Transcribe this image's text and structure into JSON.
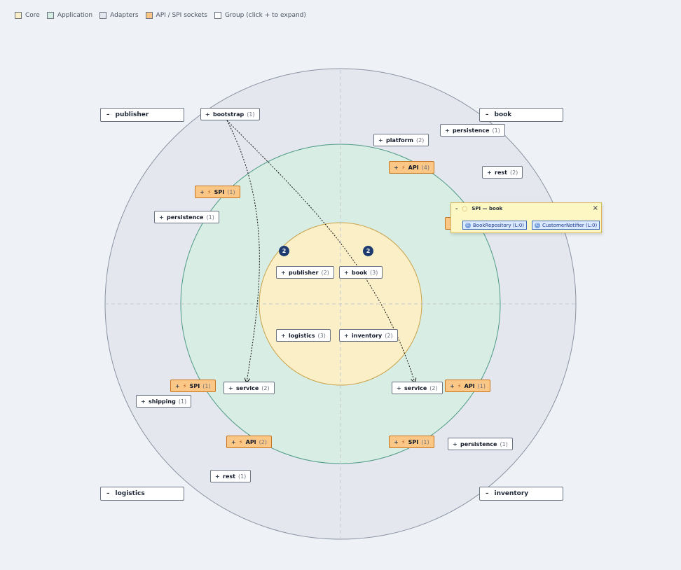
{
  "legend": [
    {
      "label": "Core",
      "color": "#fbefc7"
    },
    {
      "label": "Application",
      "color": "#d7ede3"
    },
    {
      "label": "Adapters",
      "color": "#e4e7ee"
    },
    {
      "label": "API / SPI sockets",
      "color": "#fbc787"
    },
    {
      "label": "Group (click + to expand)",
      "color": "#ffffff"
    }
  ],
  "colors": {
    "core_fill": "#fbefc7",
    "core_stroke": "#c9a24a",
    "app_fill": "#d8ede3",
    "app_stroke": "#4e9a86",
    "adapter_fill": "#e4e7ee",
    "adapter_stroke": "#8a93a3",
    "socket": "#fbc787",
    "badge": "#1e3a6e"
  },
  "groups": {
    "publisher": {
      "toggle": "–",
      "label": "publisher"
    },
    "book": {
      "toggle": "–",
      "label": "book"
    },
    "logistics": {
      "toggle": "–",
      "label": "logistics"
    },
    "inventory": {
      "toggle": "–",
      "label": "inventory"
    }
  },
  "core": {
    "publisher": {
      "toggle": "+",
      "name": "publisher",
      "count": "(2)"
    },
    "book": {
      "toggle": "+",
      "name": "book",
      "count": "(3)"
    },
    "logistics": {
      "toggle": "+",
      "name": "logistics",
      "count": "(3)"
    },
    "inventory": {
      "toggle": "+",
      "name": "inventory",
      "count": "(2)"
    },
    "badge_left": "2",
    "badge_right": "2"
  },
  "app": {
    "platform": {
      "toggle": "+",
      "name": "platform",
      "count": "(2)"
    },
    "service_left": {
      "toggle": "+",
      "name": "service",
      "count": "(2)"
    },
    "service_right": {
      "toggle": "+",
      "name": "service",
      "count": "(2)"
    }
  },
  "sockets": {
    "api_top": {
      "toggle": "+",
      "name": "API",
      "count": "(4)",
      "icon": "plug-icon"
    },
    "spi_topleft": {
      "toggle": "+",
      "name": "SPI",
      "count": "(1)",
      "icon": "plug-icon"
    },
    "spi_left": {
      "toggle": "+",
      "name": "SPI",
      "count": "(1)",
      "icon": "plug-icon"
    },
    "api_right": {
      "toggle": "+",
      "name": "API",
      "count": "(1)",
      "icon": "plug-icon"
    },
    "api_bottomleft": {
      "toggle": "+",
      "name": "API",
      "count": "(2)",
      "icon": "plug-icon"
    },
    "spi_bottomright": {
      "toggle": "+",
      "name": "SPI",
      "count": "(1)",
      "icon": "plug-icon"
    }
  },
  "adapters": {
    "bootstrap": {
      "toggle": "+",
      "name": "bootstrap",
      "count": "(1)"
    },
    "persistence_pub": {
      "toggle": "+",
      "name": "persistence",
      "count": "(1)"
    },
    "persistence_book": {
      "toggle": "+",
      "name": "persistence",
      "count": "(1)"
    },
    "rest_book": {
      "toggle": "+",
      "name": "rest",
      "count": "(2)"
    },
    "shipping": {
      "toggle": "+",
      "name": "shipping",
      "count": "(1)"
    },
    "rest_log": {
      "toggle": "+",
      "name": "rest",
      "count": "(1)"
    },
    "persistence_inv": {
      "toggle": "+",
      "name": "persistence",
      "count": "(1)"
    }
  },
  "popup": {
    "toggle": "–",
    "title": "SPI — book",
    "close": "×",
    "items": [
      {
        "icon": "C",
        "label": "BookRepository (L:0)"
      },
      {
        "icon": "C",
        "label": "CustomerNotifier (L:0)"
      }
    ]
  }
}
